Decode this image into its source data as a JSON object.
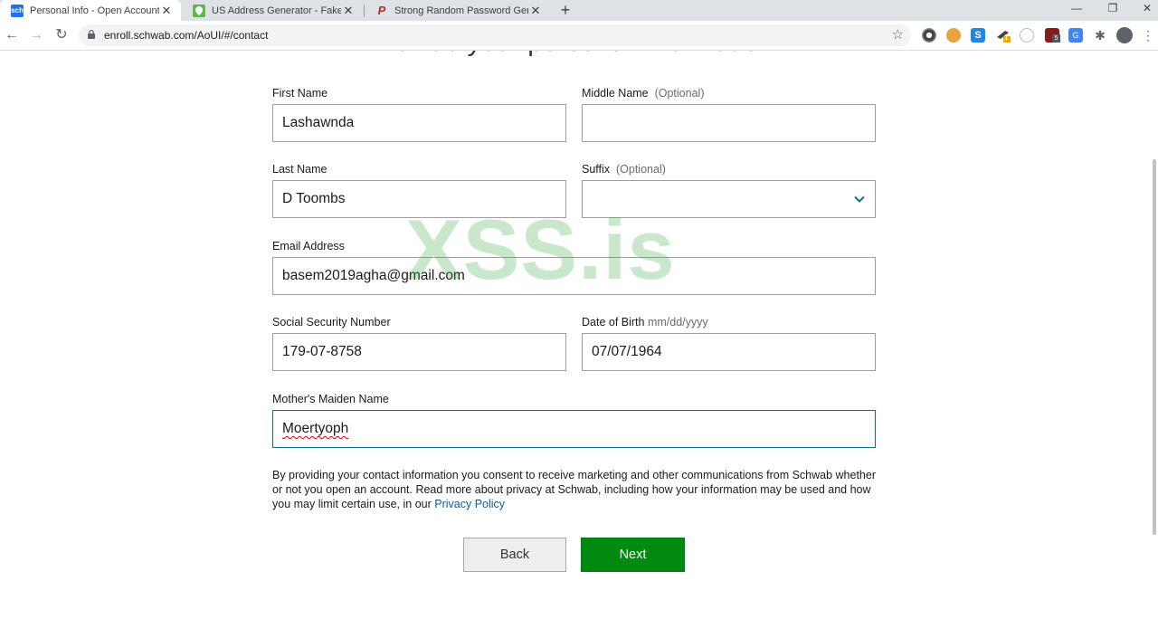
{
  "browser": {
    "tabs": [
      {
        "title": "Personal Info - Open Account | S",
        "active": true,
        "favicon_color": "#1a73e8",
        "favicon_text": "sch"
      },
      {
        "title": "US Address Generator - Fake Ad",
        "active": false,
        "favicon_color": "#5bb949"
      },
      {
        "title": "Strong Random Password Gener",
        "active": false,
        "favicon_color": "#c62828"
      }
    ],
    "url": "enroll.schwab.com/AoUI/#/contact",
    "extensions": [
      "chrome-icon",
      "cookie-icon",
      "s-icon",
      "sniper-icon",
      "circle-icon",
      "ublock-icon",
      "translate-icon",
      "puzzle-icon"
    ],
    "extension_badges": {
      "sniper": "1",
      "ublock": "5"
    }
  },
  "form": {
    "heading": "Provide your personal information.",
    "first_name": {
      "label": "First Name",
      "value": "Lashawnda"
    },
    "middle_name": {
      "label": "Middle Name",
      "optional": "(Optional)",
      "value": ""
    },
    "last_name": {
      "label": "Last Name",
      "value": "D Toombs"
    },
    "suffix": {
      "label": "Suffix",
      "optional": "(Optional)",
      "value": ""
    },
    "email": {
      "label": "Email Address",
      "value": "basem2019agha@gmail.com"
    },
    "ssn": {
      "label": "Social Security Number",
      "value": "179-07-8758"
    },
    "dob": {
      "label": "Date of Birth",
      "hint": "mm/dd/yyyy",
      "value": "07/07/1964"
    },
    "maiden_name": {
      "label": "Mother's Maiden Name",
      "value": "Moertyoph"
    },
    "consent_text": "By providing your contact information you consent to receive marketing and other communications from Schwab whether or not you open an account. Read more about privacy at Schwab, including how your information may be used and how you may limit certain use, in our",
    "privacy_link": "Privacy Policy",
    "back_label": "Back",
    "next_label": "Next"
  },
  "watermark": "XSS.is",
  "colors": {
    "accent": "#0e6f8f",
    "next_button": "#008a10",
    "link": "#0b5c9e"
  }
}
